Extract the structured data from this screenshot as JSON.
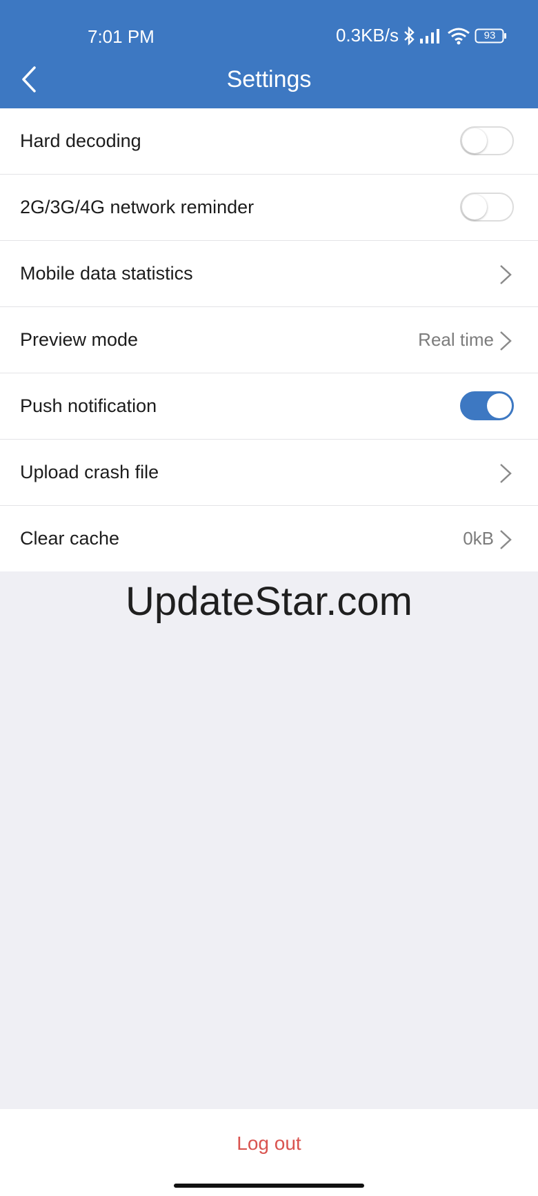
{
  "status_bar": {
    "time": "7:01 PM",
    "net_speed": "0.3KB/s",
    "battery": "93"
  },
  "header": {
    "title": "Settings"
  },
  "settings": [
    {
      "label": "Hard decoding",
      "control": "toggle",
      "on": false
    },
    {
      "label": "2G/3G/4G network reminder",
      "control": "toggle",
      "on": false
    },
    {
      "label": "Mobile data statistics",
      "control": "chevron",
      "value": ""
    },
    {
      "label": "Preview mode",
      "control": "chevron",
      "value": "Real time"
    },
    {
      "label": "Push notification",
      "control": "toggle",
      "on": true
    },
    {
      "label": "Upload crash file",
      "control": "chevron",
      "value": ""
    },
    {
      "label": "Clear cache",
      "control": "chevron",
      "value": "0kB"
    }
  ],
  "watermark": "UpdateStar.com",
  "footer": {
    "logout_label": "Log out"
  },
  "colors": {
    "accent": "#3d78c2",
    "logout": "#d9534f",
    "background": "#efeff4"
  }
}
